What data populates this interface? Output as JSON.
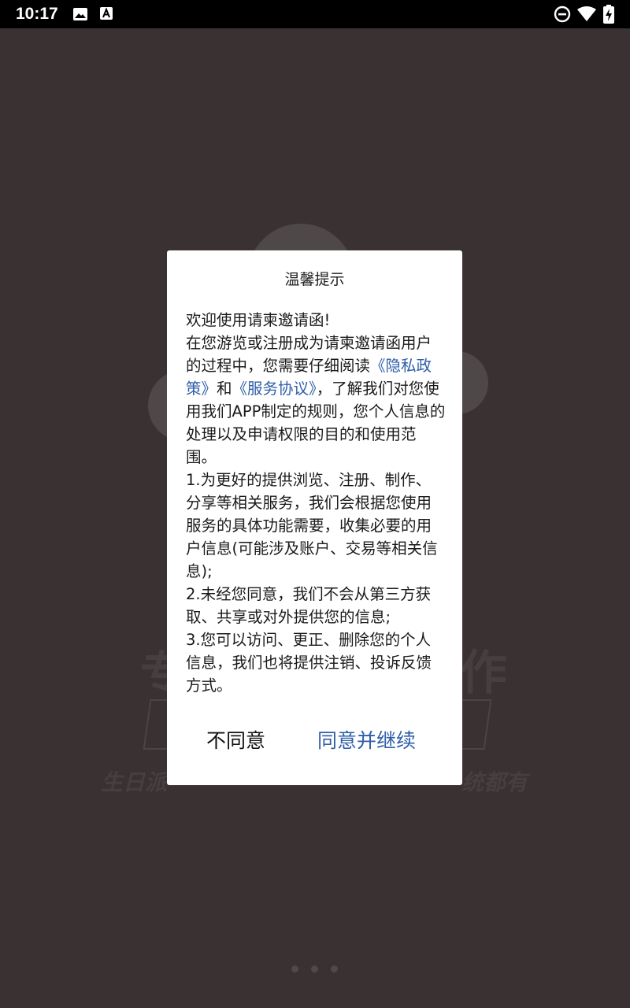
{
  "status_bar": {
    "time": "10:17",
    "icons": [
      "image-icon",
      "a-icon",
      "do-not-disturb-icon",
      "wifi-icon",
      "battery-charging-icon"
    ]
  },
  "background": {
    "big_left": "专",
    "big_right": "作",
    "tagline_left": "生日派",
    "tagline_right": "统都有"
  },
  "dialog": {
    "title": "温馨提示",
    "intro": "欢迎使用请柬邀请函!",
    "paragraph1": {
      "before": "在您游览或注册成为请柬邀请函用户的过程中，您需要仔细阅读",
      "link1": "《隐私政策》",
      "middle": "和",
      "link2": "《服务协议》",
      "after": "，了解我们对您使用我们APP制定的规则，您个人信息的处理以及申请权限的目的和使用范围。"
    },
    "item1": "1.为更好的提供浏览、注册、制作、分享等相关服务，我们会根据您使用服务的具体功能需要，收集必要的用户信息(可能涉及账户、交易等相关信息);",
    "item2": "2.未经您同意，我们不会从第三方获取、共享或对外提供您的信息;",
    "item3": "3.您可以访问、更正、删除您的个人信息，我们也将提供注销、投诉反馈方式。",
    "disagree_label": "不同意",
    "agree_label": "同意并继续"
  },
  "colors": {
    "link": "#2f5ea8",
    "backdrop": "#3a3232",
    "status_bar": "#000000"
  }
}
